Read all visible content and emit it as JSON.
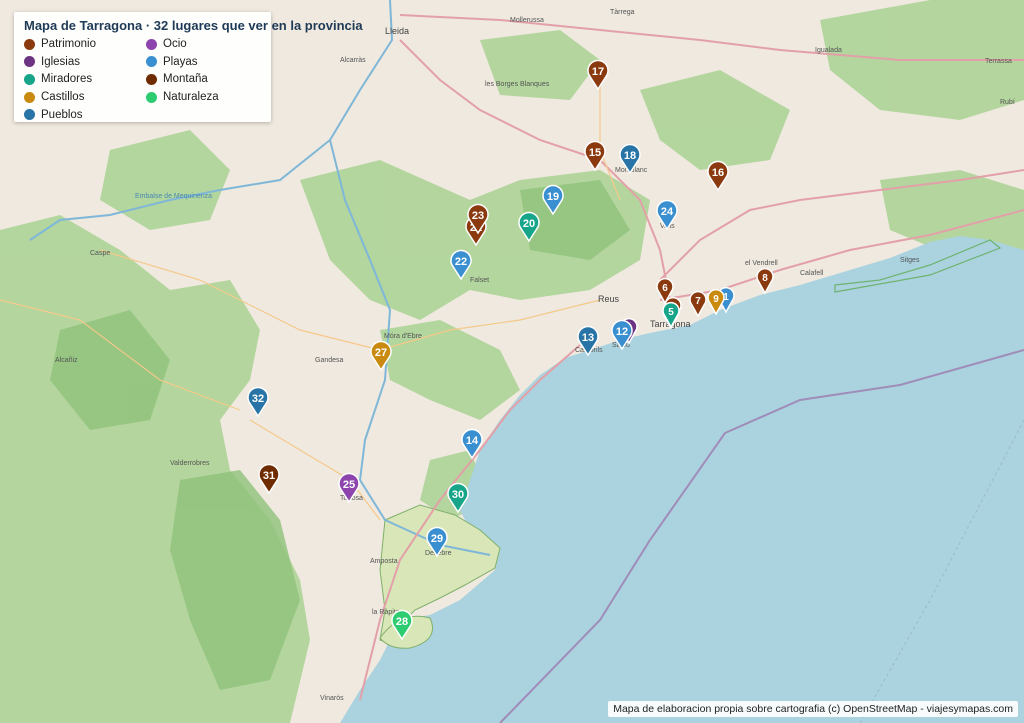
{
  "legend": {
    "title": "Mapa de Tarragona · 32 lugares que ver en la provincia",
    "categories": [
      {
        "key": "patrimonio",
        "label": "Patrimonio",
        "color": "#8B3A0F"
      },
      {
        "key": "ocio",
        "label": "Ocio",
        "color": "#8E44AD"
      },
      {
        "key": "iglesias",
        "label": "Iglesias",
        "color": "#6C3483"
      },
      {
        "key": "playas",
        "label": "Playas",
        "color": "#3A8FD0"
      },
      {
        "key": "miradores",
        "label": "Miradores",
        "color": "#17A589"
      },
      {
        "key": "montana",
        "label": "Montaña",
        "color": "#6E2C00"
      },
      {
        "key": "castillos",
        "label": "Castillos",
        "color": "#CA8A10"
      },
      {
        "key": "naturaleza",
        "label": "Naturaleza",
        "color": "#2ECC71"
      },
      {
        "key": "pueblos",
        "label": "Pueblos",
        "color": "#2874A6"
      }
    ]
  },
  "attribution": "Mapa de elaboracion propia sobre cartografia (c) OpenStreetMap - viajesymapas.com",
  "place_labels": {
    "lleida": "Lleida",
    "reus": "Reus",
    "tarragona": "Tarragona",
    "tortosa": "Tortosa",
    "gandesa": "Gandesa",
    "falset": "Falset",
    "montblanc": "Montblanc",
    "valls": "Valls",
    "terrassa": "Terrassa",
    "rubi": "Rubí",
    "amposta": "Amposta",
    "deltebre": "Deltebre",
    "lerapita": "la Ràpita",
    "vinaros": "Vinaròs",
    "calafell": "Calafell",
    "sitges": "Sitges",
    "vendrell": "el Vendrell",
    "cambrils": "Cambrils",
    "salou": "Salou",
    "alcanyis": "Alcañiz",
    "valderrobres": "Valderrobres",
    "caspe": "Caspe",
    "mora": "Móra d'Ebre",
    "tarrega": "Tàrrega",
    "mollerussa": "Mollerussa",
    "borges": "les Borges Blanques",
    "igualada": "Igualada",
    "alcarras": "Alcarràs",
    "embalse": "Embalse de Mequinenza"
  },
  "markers": [
    {
      "n": "1",
      "cat": "playas"
    },
    {
      "n": "2",
      "cat": "patrimonio"
    },
    {
      "n": "3",
      "cat": "iglesias"
    },
    {
      "n": "4",
      "cat": "pueblos"
    },
    {
      "n": "5",
      "cat": "miradores"
    },
    {
      "n": "6",
      "cat": "patrimonio"
    },
    {
      "n": "7",
      "cat": "patrimonio"
    },
    {
      "n": "8",
      "cat": "patrimonio"
    },
    {
      "n": "9",
      "cat": "castillos"
    },
    {
      "n": "12",
      "cat": "playas"
    },
    {
      "n": "13",
      "cat": "pueblos"
    },
    {
      "n": "14",
      "cat": "playas"
    },
    {
      "n": "15",
      "cat": "patrimonio"
    },
    {
      "n": "16",
      "cat": "patrimonio"
    },
    {
      "n": "17",
      "cat": "patrimonio"
    },
    {
      "n": "18",
      "cat": "pueblos"
    },
    {
      "n": "19",
      "cat": "playas"
    },
    {
      "n": "20",
      "cat": "miradores"
    },
    {
      "n": "21",
      "cat": "patrimonio"
    },
    {
      "n": "22",
      "cat": "playas"
    },
    {
      "n": "23",
      "cat": "patrimonio"
    },
    {
      "n": "24",
      "cat": "playas"
    },
    {
      "n": "25",
      "cat": "ocio"
    },
    {
      "n": "27",
      "cat": "castillos"
    },
    {
      "n": "28",
      "cat": "naturaleza"
    },
    {
      "n": "29",
      "cat": "playas"
    },
    {
      "n": "30",
      "cat": "miradores"
    },
    {
      "n": "31",
      "cat": "montana"
    },
    {
      "n": "32",
      "cat": "pueblos"
    }
  ]
}
